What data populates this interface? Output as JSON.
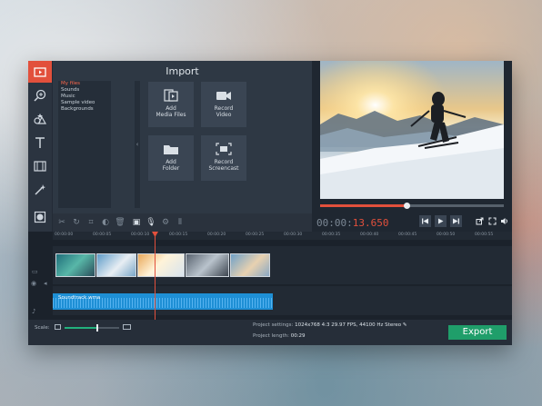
{
  "import": {
    "title": "Import",
    "file_categories": [
      {
        "label": "My files",
        "selected": true
      },
      {
        "label": "Sounds",
        "selected": false
      },
      {
        "label": "Music",
        "selected": false
      },
      {
        "label": "Sample video",
        "selected": false
      },
      {
        "label": "Backgrounds",
        "selected": false
      }
    ],
    "tiles": [
      {
        "line1": "Add",
        "line2": "Media Files",
        "icon": "media-files-icon"
      },
      {
        "line1": "Record",
        "line2": "Video",
        "icon": "video-camera-icon"
      },
      {
        "line1": "Add",
        "line2": "Folder",
        "icon": "folder-icon"
      },
      {
        "line1": "Record",
        "line2": "Screencast",
        "icon": "screencast-icon"
      }
    ]
  },
  "player": {
    "time_dim": "00:00:",
    "time_hi": "13.650",
    "progress": 0.47
  },
  "timeline": {
    "ticks": [
      "00:00:00",
      "00:00:05",
      "00:00:10",
      "00:00:15",
      "00:00:20",
      "00:00:25",
      "00:00:30",
      "00:00:35",
      "00:00:40",
      "00:00:45",
      "00:00:50",
      "00:00:55"
    ],
    "audio_clip": "Soundtrack.wma"
  },
  "bottom": {
    "scale_label": "Scale:",
    "settings_label": "Project settings:",
    "settings_value": "1024x768 4:3 29.97 FPS, 44100 Hz Stereo",
    "length_label": "Project length:",
    "length_value": "00:29",
    "export_label": "Export",
    "scale_level": 0.6
  },
  "colors": {
    "accent": "#e2503c",
    "export": "#1f9e6a",
    "audio": "#1e8fd5"
  }
}
